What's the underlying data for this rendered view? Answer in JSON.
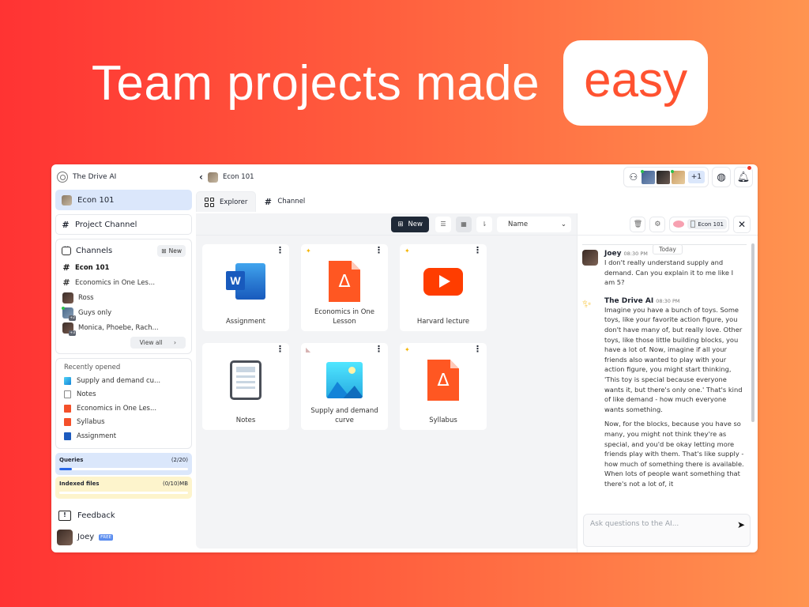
{
  "headline": {
    "lead": "Team projects made",
    "highlight": "easy"
  },
  "app": {
    "name": "The Drive AI"
  },
  "sidebar": {
    "workspace": "Econ 101",
    "project_channel": "Project Channel",
    "channels": {
      "title": "Channels",
      "new_label": "New",
      "items": [
        {
          "type": "channel",
          "label": "Econ 101",
          "bold": true
        },
        {
          "type": "channel",
          "label": "Economics in One Les..."
        },
        {
          "type": "dm",
          "label": "Ross",
          "badge": ""
        },
        {
          "type": "group",
          "label": "Guys only",
          "badge": "+2"
        },
        {
          "type": "group",
          "label": "Monica, Phoebe, Rach...",
          "badge": "+3"
        }
      ],
      "view_all": "View all"
    },
    "recent": {
      "title": "Recently opened",
      "items": [
        {
          "icon": "image",
          "label": "Supply and demand cu..."
        },
        {
          "icon": "note",
          "label": "Notes"
        },
        {
          "icon": "pdf",
          "label": "Economics in One Les..."
        },
        {
          "icon": "pdf",
          "label": "Syllabus"
        },
        {
          "icon": "word",
          "label": "Assignment"
        }
      ]
    },
    "queries": {
      "label": "Queries",
      "value": "(2/20)",
      "progress": 0.1
    },
    "indexed": {
      "label": "Indexed files",
      "value": "(0/10)MB",
      "progress": 0
    },
    "feedback": "Feedback",
    "user": {
      "name": "Joey",
      "plan": "FREE"
    }
  },
  "topbar": {
    "breadcrumb": "Econ 101",
    "extra_members": "+1",
    "notifications": 0
  },
  "tabs": [
    {
      "label": "Explorer",
      "active": true
    },
    {
      "label": "Channel",
      "active": false
    }
  ],
  "toolbar": {
    "new_label": "New",
    "sort_value": "Name"
  },
  "files": [
    {
      "name": "Assignment",
      "icon": "word",
      "ai": false
    },
    {
      "name": "Economics in One Lesson",
      "icon": "pdf",
      "ai": true
    },
    {
      "name": "Harvard lecture",
      "icon": "youtube",
      "ai": true
    },
    {
      "name": "Notes",
      "icon": "note",
      "ai": false
    },
    {
      "name": "Supply and demand curve",
      "icon": "image",
      "ai": false
    },
    {
      "name": "Syllabus",
      "icon": "pdf",
      "ai": true
    }
  ],
  "chat": {
    "context_label": "Econ 101",
    "date_divider": "Today",
    "messages": [
      {
        "author": "Joey",
        "time": "08:30 PM",
        "paragraphs": [
          "I don't really understand supply and demand. Can you explain it to me like I am 5?"
        ]
      },
      {
        "author": "The Drive AI",
        "time": "08:30 PM",
        "paragraphs": [
          "Imagine you have a bunch of toys. Some toys, like your favorite action figure, you don't have many of, but really love. Other toys, like those little building blocks, you have a lot of. Now, imagine if all your friends also wanted to play with your action figure, you might start thinking, 'This toy is special because everyone wants it, but there's only one.' That's kind of like demand - how much everyone wants something.",
          "Now, for the blocks, because you have so many, you might not think they're as special, and you'd be okay letting more friends play with them. That's like supply - how much of something there is available. When lots of people want something that there's not a lot of, it"
        ]
      }
    ],
    "input_placeholder": "Ask questions to the AI..."
  }
}
